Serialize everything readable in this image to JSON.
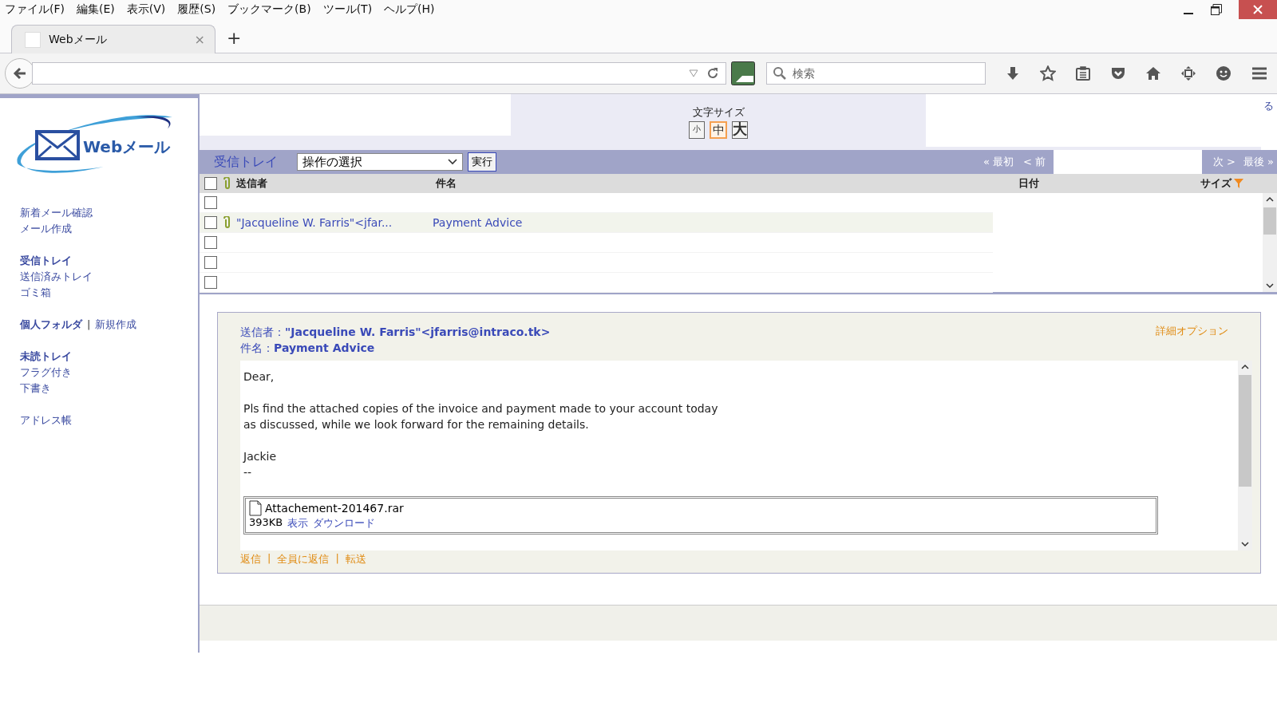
{
  "menu": [
    "ファイル(F)",
    "編集(E)",
    "表示(V)",
    "履歴(S)",
    "ブックマーク(B)",
    "ツール(T)",
    "ヘルプ(H)"
  ],
  "tab": {
    "title": "Webメール",
    "close": "×",
    "new_tab": "+"
  },
  "search": {
    "placeholder": "検索"
  },
  "logo": {
    "text": "Webメール"
  },
  "sidebar": {
    "groups": [
      [
        {
          "label": "新着メール確認",
          "bold": false
        },
        {
          "label": "メール作成",
          "bold": false
        }
      ],
      [
        {
          "label": "受信トレイ",
          "bold": true
        },
        {
          "label": "送信済みトレイ",
          "bold": false
        },
        {
          "label": "ゴミ箱",
          "bold": false
        }
      ],
      [
        {
          "label": "個人フォルダ",
          "bold": true,
          "separator": "|",
          "extra": "新規作成"
        }
      ],
      [
        {
          "label": "未読トレイ",
          "bold": true
        },
        {
          "label": "フラグ付き",
          "bold": false
        },
        {
          "label": "下書き",
          "bold": false
        }
      ],
      [
        {
          "label": "アドレス帳",
          "bold": false
        }
      ]
    ]
  },
  "font_size": {
    "label": "文字サイズ",
    "options": [
      {
        "label": "小",
        "selected": false
      },
      {
        "label": "中",
        "selected": true
      },
      {
        "label": "大",
        "selected": false
      }
    ]
  },
  "corner_link": "る",
  "toolbar": {
    "folder": "受信トレイ",
    "action_select": "操作の選択",
    "run_button": "実行",
    "pager_left": [
      "« 最初",
      "< 前"
    ],
    "pager_right": [
      "次 >",
      "最後 »"
    ]
  },
  "list": {
    "select_all_checked": false,
    "columns": [
      "送信者",
      "件名",
      "日付",
      "サイズ"
    ],
    "rows": [
      {
        "checked": false,
        "selected": false,
        "attachment": false
      },
      {
        "checked": false,
        "selected": true,
        "attachment": true,
        "sender": "\"Jacqueline W. Farris\"<jfar...",
        "subject": "Payment Advice"
      },
      {
        "checked": false,
        "selected": false,
        "attachment": false
      },
      {
        "checked": false,
        "selected": false,
        "attachment": false
      },
      {
        "checked": false,
        "selected": false,
        "attachment": false
      }
    ]
  },
  "message": {
    "from_label": "送信者：",
    "from": "\"Jacqueline W. Farris\"<jfarris@intraco.tk>",
    "subject_label": "件名：",
    "subject": "Payment Advice",
    "options_link": "詳細オプション",
    "body": [
      [
        "Dear,"
      ],
      [
        "Pls find the attached copies of the invoice and payment made to your account today",
        "as discussed, while we look forward for the remaining details."
      ],
      [
        "Jackie",
        "--"
      ]
    ],
    "attachment": {
      "name": "Attachement-201467.rar",
      "size": "393KB",
      "view": "表示",
      "download": "ダウンロード"
    },
    "actions": [
      "返信",
      "全員に返信",
      "転送"
    ],
    "separator": "|"
  }
}
